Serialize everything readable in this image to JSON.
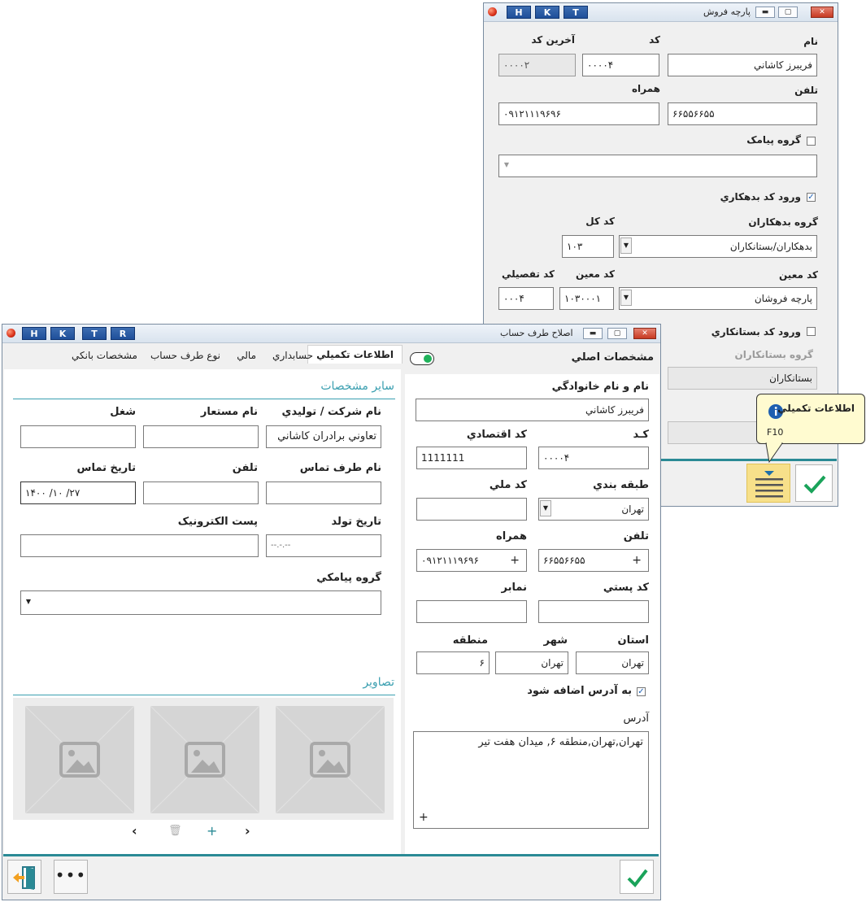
{
  "win1": {
    "title": "پارچه فروش",
    "hk": [
      "H",
      "K",
      "T"
    ],
    "labels": {
      "name": "نام",
      "code": "کد",
      "last_code": "آخرين کد",
      "phone": "تلفن",
      "mobile": "همراه",
      "sms_group": "گروه پيامک",
      "debtor_enter": "ورود کد بدهکاري",
      "debtor_group": "گروه بدهکاران",
      "general_code": "کد کل",
      "moein_code": "کد معين",
      "moein_code2": "کد معين",
      "detail_code": "کد تفصيلي",
      "creditor_enter": "ورود کد بستانکاري",
      "creditor_group": "گروه بستانکاران"
    },
    "values": {
      "name": "فريبرز کاشاني",
      "code": "۰۰۰۰۴",
      "last_code": "۰۰۰۰۲",
      "phone": "۶۶۵۵۶۶۵۵",
      "mobile": "۰۹۱۲۱۱۱۹۶۹۶",
      "debtor_group": "بدهکاران/بستانکاران",
      "general_code": "۱۰۳",
      "moein": "پارچه فروشان",
      "moein_code": "۱۰۳۰۰۰۱",
      "detail_code": "۰۰۰۴",
      "creditor_group": "بستانکاران"
    },
    "debtor_checked": true,
    "sms_checked": false,
    "creditor_checked": false
  },
  "tooltip": {
    "title": "اطلاعات تکميلي",
    "shortcut": "F10"
  },
  "win2": {
    "title": "اصلاح طرف حساب",
    "hk": [
      "H",
      "K",
      "T",
      "R"
    ],
    "right_header": "مشخصات اصلي",
    "tabs": [
      "اطلاعات تکميلي",
      "حسابداري",
      "مالي",
      "نوع طرف حساب",
      "مشخصات بانکي"
    ],
    "right": {
      "fullname_label": "نام و نام خانوادگي",
      "fullname": "فريبرز کاشاني",
      "code_label": "کـد",
      "code": "۰۰۰۰۴",
      "econ_label": "کد اقتصادي",
      "econ": "1111111",
      "class_label": "طبقه بندي",
      "class": "تهران",
      "national_label": "کد ملي",
      "national": "",
      "phone_label": "تلفن",
      "phone": "۶۶۵۵۶۶۵۵",
      "mobile_label": "همراه",
      "mobile": "۰۹۱۲۱۱۱۹۶۹۶",
      "postal_label": "کد پستي",
      "postal": "",
      "fax_label": "نمابر",
      "fax": "",
      "province_label": "استان",
      "province": "تهران",
      "city_label": "شهر",
      "city": "تهران",
      "region_label": "منطقه",
      "region": "۶",
      "add_to_address": "به آدرس اضافه شود",
      "address_label": "آدرس",
      "address": "تهران,تهران,منطقه ۶, ميدان هفت تير"
    },
    "left": {
      "section_title": "ساير مشخصات",
      "company_label": "نام شرکت / توليدي",
      "company": "تعاوني برادران کاشاني",
      "alias_label": "نام مستعار",
      "alias": "",
      "job_label": "شغل",
      "job": "",
      "contact_label": "نام طرف تماس",
      "contact": "",
      "phone_label": "تلفن",
      "phone": "",
      "contact_date_label": "تاريخ تماس",
      "contact_date": "۱۴۰۰  /۱۰  /۲۷",
      "birth_label": "تاريخ تولد",
      "birth": "--.-.--",
      "email_label": "پست الکترونيک",
      "email": "",
      "sms_group_label": "گروه پيامکي",
      "images_title": "تصاوير"
    }
  }
}
